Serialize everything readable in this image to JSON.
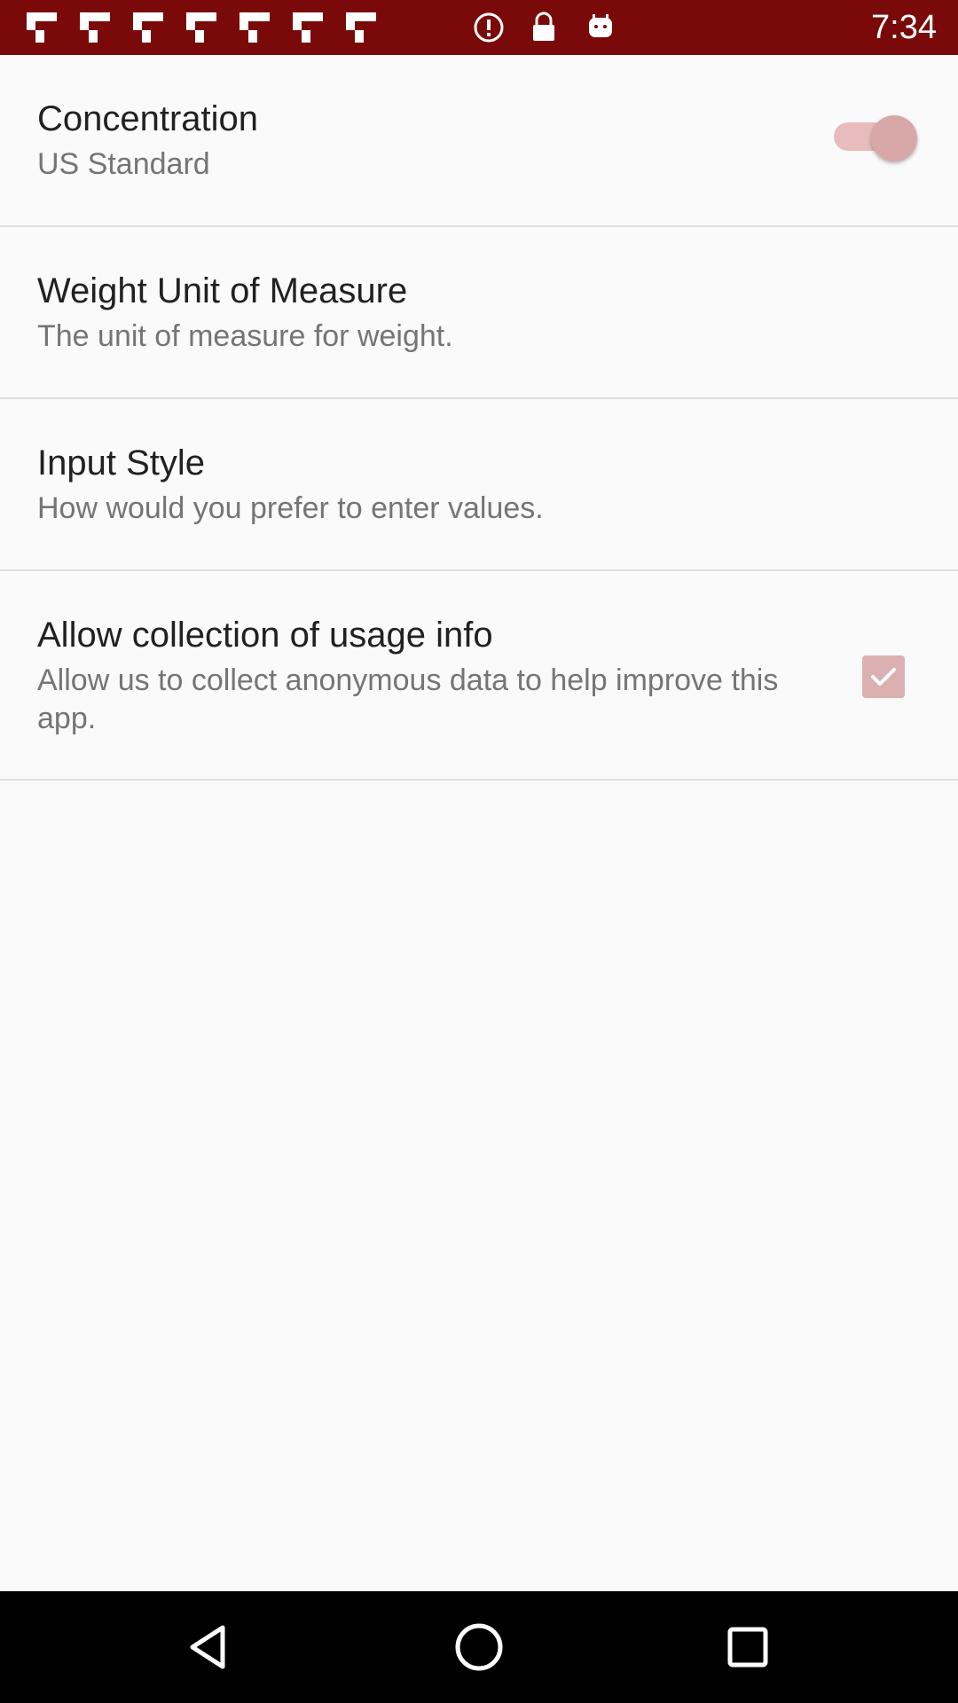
{
  "status_bar": {
    "time": "7:34",
    "background": "#7a0a0a",
    "left_icons": [
      "flipboard-icon",
      "flipboard-icon",
      "flipboard-icon",
      "flipboard-icon",
      "flipboard-icon",
      "flipboard-icon",
      "flipboard-icon",
      "info-icon",
      "lock-icon",
      "android-icon"
    ]
  },
  "settings": [
    {
      "title": "Concentration",
      "subtitle": "US Standard",
      "control": "switch",
      "checked": true
    },
    {
      "title": "Weight Unit of Measure",
      "subtitle": "The unit of measure for weight."
    },
    {
      "title": "Input Style",
      "subtitle": "How would you prefer to enter values."
    },
    {
      "title": "Allow collection of usage info",
      "subtitle": "Allow us to collect anonymous data to help improve this app.",
      "control": "checkbox",
      "checked": true
    }
  ],
  "nav_bar": {
    "buttons": [
      "back-icon",
      "home-icon",
      "recents-icon"
    ]
  },
  "colors": {
    "accent": "#d8a8a8",
    "divider": "#e0e0e0",
    "background": "#fafafa"
  }
}
